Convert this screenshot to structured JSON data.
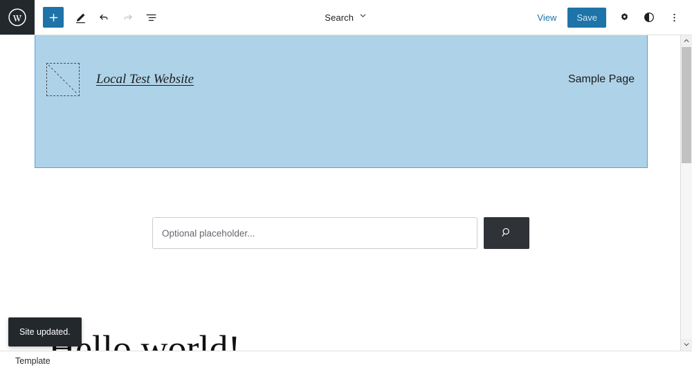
{
  "toolbar": {
    "logo_icon": "wordpress-logo-icon",
    "add_block_label": "+",
    "add_block_icon": "plus-icon",
    "edit_icon": "pencil-edit-icon",
    "undo_icon": "undo-arrow-icon",
    "redo_icon": "redo-arrow-icon",
    "list_view_icon": "list-view-icon",
    "document_title": "Search",
    "document_chevron_icon": "chevron-down-icon",
    "view_label": "View",
    "save_label": "Save",
    "settings_icon": "gear-icon",
    "styles_icon": "contrast-half-circle-icon",
    "options_icon": "three-dots-vertical-icon",
    "accent_color": "#1e73a8",
    "save_text_color": "#cfe4f1",
    "logo_bg_color": "#23282d"
  },
  "canvas": {
    "site_header": {
      "background_color": "#aed3e8",
      "selection_border_color": "#5a9fd4",
      "logo_placeholder_icon": "image-placeholder-icon",
      "site_title": "Local Test Website",
      "nav_items": [
        {
          "label": "Sample Page"
        }
      ]
    },
    "search_block": {
      "input_value": "",
      "input_placeholder": "Optional placeholder...",
      "button_icon": "search-magnifier-icon",
      "button_color": "#2f3337"
    },
    "post": {
      "title": "Hello world!"
    }
  },
  "scrollbar": {
    "up_arrow_icon": "chevron-up-icon",
    "down_arrow_icon": "chevron-down-icon"
  },
  "bottom_bar": {
    "breadcrumb_label": "Template"
  },
  "toast": {
    "message": "Site updated.",
    "background_color": "#23282d"
  }
}
